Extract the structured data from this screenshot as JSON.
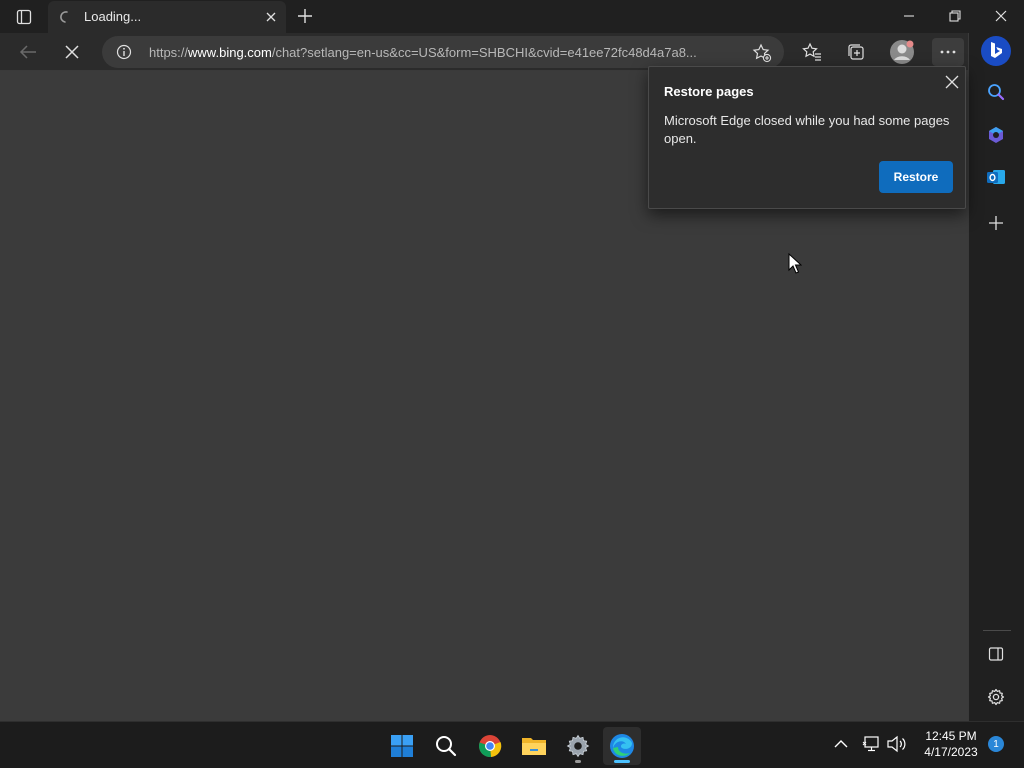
{
  "tab": {
    "title": "Loading..."
  },
  "address_bar": {
    "url_prefix": "https://",
    "url_host": "www.bing.com",
    "url_rest": "/chat?setlang=en-us&cc=US&form=SHBCHI&cvid=e41ee72fc48d4a7a8..."
  },
  "restore_popup": {
    "title": "Restore pages",
    "body": "Microsoft Edge closed while you had some pages open.",
    "button_label": "Restore"
  },
  "taskbar": {
    "time": "12:45 PM",
    "date": "4/17/2023",
    "notification_count": "1"
  },
  "colors": {
    "accent_button": "#0f6cbd",
    "content_bg": "#3b3b3b",
    "chrome_bg": "#202020",
    "toolbar_bg": "#2b2b2b"
  }
}
